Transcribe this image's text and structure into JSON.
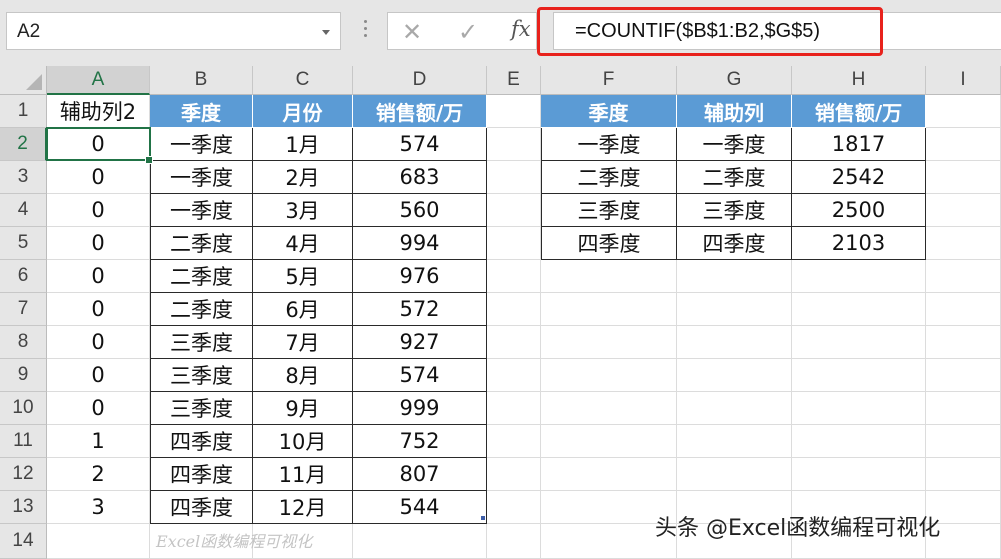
{
  "formula_bar": {
    "name_box": "A2",
    "cancel_icon": "✕",
    "enter_icon": "✓",
    "fx_icon": "fx",
    "formula": "=COUNTIF($B$1:B2,$G$5)"
  },
  "columns": [
    "A",
    "B",
    "C",
    "D",
    "E",
    "F",
    "G",
    "H",
    "I"
  ],
  "rows": [
    "1",
    "2",
    "3",
    "4",
    "5",
    "6",
    "7",
    "8",
    "9",
    "10",
    "11",
    "12",
    "13",
    "14"
  ],
  "sheet": {
    "a1": "辅助列2",
    "left_table": {
      "headers": [
        "季度",
        "月份",
        "销售额/万"
      ],
      "rows": [
        [
          "0",
          "一季度",
          "1月",
          "574"
        ],
        [
          "0",
          "一季度",
          "2月",
          "683"
        ],
        [
          "0",
          "一季度",
          "3月",
          "560"
        ],
        [
          "0",
          "二季度",
          "4月",
          "994"
        ],
        [
          "0",
          "二季度",
          "5月",
          "976"
        ],
        [
          "0",
          "二季度",
          "6月",
          "572"
        ],
        [
          "0",
          "三季度",
          "7月",
          "927"
        ],
        [
          "0",
          "三季度",
          "8月",
          "574"
        ],
        [
          "0",
          "三季度",
          "9月",
          "999"
        ],
        [
          "1",
          "四季度",
          "10月",
          "752"
        ],
        [
          "2",
          "四季度",
          "11月",
          "807"
        ],
        [
          "3",
          "四季度",
          "12月",
          "544"
        ]
      ]
    },
    "right_table": {
      "headers": [
        "季度",
        "辅助列",
        "销售额/万"
      ],
      "rows": [
        [
          "一季度",
          "一季度",
          "1817"
        ],
        [
          "二季度",
          "二季度",
          "2542"
        ],
        [
          "三季度",
          "三季度",
          "2500"
        ],
        [
          "四季度",
          "四季度",
          "2103"
        ]
      ]
    }
  },
  "watermark_small": "Excel函数编程可视化",
  "watermark_big": "头条 @Excel函数编程可视化",
  "colors": {
    "header_fill": "#5b9bd5",
    "selection": "#217346",
    "highlight_box": "#e8221c"
  }
}
